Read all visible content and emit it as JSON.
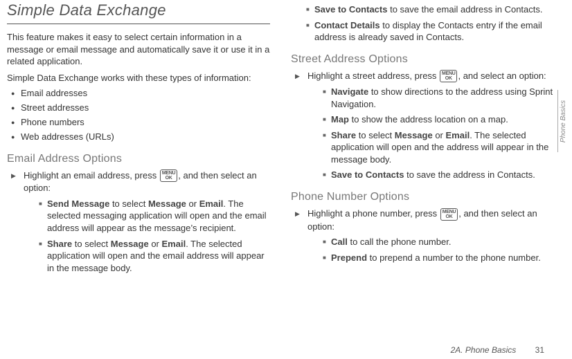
{
  "left": {
    "title": "Simple Data Exchange",
    "intro1": "This feature makes it easy to select certain information in a message or email message and automatically save it or use it in a related application.",
    "intro2": "Simple Data Exchange works with these types of information:",
    "types": [
      "Email addresses",
      "Street addresses",
      "Phone numbers",
      "Web addresses (URLs)"
    ],
    "email": {
      "heading": "Email Address Options",
      "step_pre": "Highlight an email address, press ",
      "step_post": ", and then select an option:",
      "items": [
        {
          "lead": "Send Message",
          "mid": " to select ",
          "b1": "Message",
          "or": " or ",
          "b2": "Email",
          "tail": ". The selected messaging application will open and the email address will appear as the message’s recipient."
        },
        {
          "lead": "Share",
          "mid": " to select ",
          "b1": "Message",
          "or": " or ",
          "b2": "Email",
          "tail": ". The selected application will open and the email address will appear in the message body."
        }
      ]
    }
  },
  "right": {
    "email_cont": [
      {
        "lead": "Save to Contacts",
        "tail": " to save the email address in Contacts."
      },
      {
        "lead": "Contact Details",
        "tail": " to display the Contacts entry if the email address is already saved in Contacts."
      }
    ],
    "street": {
      "heading": "Street Address Options",
      "step_pre": "Highlight a street address, press ",
      "step_post": ", and select an option:",
      "items": [
        {
          "lead": "Navigate",
          "tail": " to show directions to the address using Sprint Navigation."
        },
        {
          "lead": "Map",
          "tail": " to show the address location on a map."
        },
        {
          "lead": "Share",
          "mid": " to select ",
          "b1": "Message",
          "or": " or ",
          "b2": "Email",
          "tail": ". The selected application will open and the address will appear in the message body."
        },
        {
          "lead": "Save to Contacts",
          "tail": " to save the address in Contacts."
        }
      ]
    },
    "phone": {
      "heading": "Phone Number Options",
      "step_pre": "Highlight a phone number, press ",
      "step_post": ", and then select an option:",
      "items": [
        {
          "lead": "Call",
          "tail": " to call the phone number."
        },
        {
          "lead": "Prepend",
          "tail": " to prepend a number to the phone number."
        }
      ]
    }
  },
  "ok_label_top": "MENU",
  "ok_label_bot": "OK",
  "sidetab": "Phone Basics",
  "footer": {
    "section": "2A. Phone Basics",
    "page": "31"
  }
}
